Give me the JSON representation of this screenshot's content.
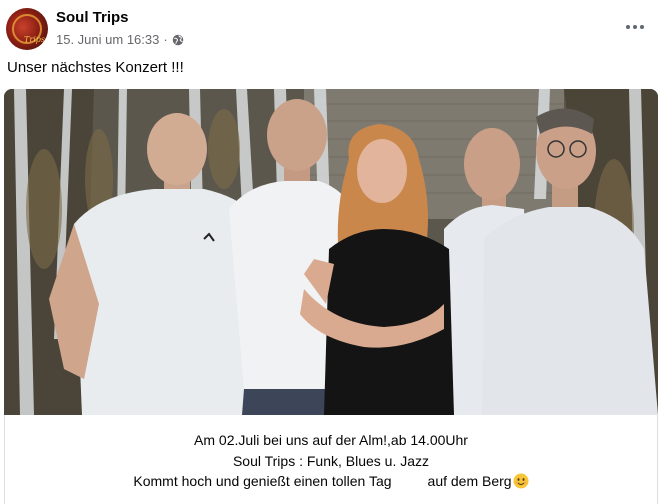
{
  "post": {
    "author": "Soul Trips",
    "timestamp": "15. Juni um 16:33",
    "separator": "·",
    "audience_icon": "globe-icon",
    "more_icon": "more-horizontal-icon",
    "text": "Unser nächstes Konzert !!!"
  },
  "caption": {
    "line1": "Am 02.Juli bei uns auf der Alm!,ab 14.00Uhr",
    "line2": "Soul Trips : Funk, Blues u. Jazz",
    "line3_part1": "Kommt hoch und genießt einen tollen Tag",
    "line3_part2": "auf dem Berg",
    "emoji_icon": "smiling-face-icon"
  },
  "colors": {
    "text_primary": "#050505",
    "text_secondary": "#65676b",
    "divider": "#dadde1"
  }
}
